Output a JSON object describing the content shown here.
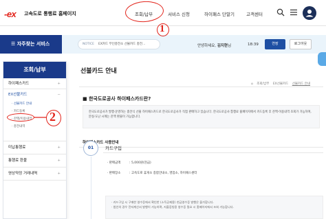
{
  "header": {
    "logo_text": "-ex",
    "site_name": "고속도로 통행료 홈페이지",
    "nav": [
      "조회/납부",
      "서비스 신청",
      "하이패스 단말기",
      "고객센터"
    ],
    "icons": [
      "search-icon",
      "menu-icon",
      "user-icon"
    ]
  },
  "notice_bar": {
    "favorites_label": "자주찾는 서비스",
    "notice_tag": "NOTICE",
    "notice_text": "EX카드 무인충전소 선불카드 충전...",
    "greeting_prefix": "안녕하세요,",
    "user_name": "김지현",
    "greeting_suffix": "님",
    "session_timer": "18:39",
    "extend_label": "연장",
    "logout_label": "로그아웃"
  },
  "sidebar": {
    "title": "조회/납부",
    "items": [
      {
        "label": "하이패스카드",
        "toggle": "+"
      },
      {
        "label": "EX선불카드",
        "toggle": "−"
      },
      {
        "label": "미납통행료",
        "toggle": "+"
      },
      {
        "label": "통행료 환불",
        "toggle": "+"
      },
      {
        "label": "영상약정 거래내역",
        "toggle": "+"
      }
    ],
    "subitems": [
      "선불카드 안내",
      "카드등록",
      "잔액/이용내역",
      "충전내역"
    ]
  },
  "content": {
    "page_title": "선불카드 안내",
    "breadcrumb": [
      "⌂",
      "조회/납부",
      "EX선불카드",
      "선불카드 안내"
    ],
    "section_title": "한국도로공사 하이패스카드란?",
    "description": "한국도로공사가 발행·운영하는 충전식 선불 하이패스카드로 한국도로공사가 직접 판매하고 있습니다. 한국도로공사 통행료 홈페이지에서 카드등록 후 잔액·이용내역 조회가 가능하며, 분실·도난 시에는 잔액 환불이 가능합니다.",
    "usage_title": "하이패스카드 사용안내",
    "step_number": "01",
    "step_title": "카드구입",
    "details": [
      {
        "label": "판매금액",
        "value": "5,000원(현금)"
      },
      {
        "label": "판매장소",
        "value": "고속도로 휴게소 종합안내소, 영업소, 하이패스센터"
      }
    ],
    "notes": [
      "· 카드구입 시 구매한 영수증에서 확인한 (소득공제용) 현금영수증 발행은 불가합니다.",
      "· 법인의 경우 전자계산서 발행이 가능하며, 지출증빙용 영수증 필요 시 홈페이지에서 조회 가능합니다."
    ]
  },
  "annotations": {
    "circle_1": "1",
    "circle_2": "2"
  },
  "colors": {
    "brand_red": "#e2231a",
    "brand_navy": "#1a3a8a",
    "accent_blue": "#1e4fa3",
    "annotation_red": "#e2231a"
  }
}
